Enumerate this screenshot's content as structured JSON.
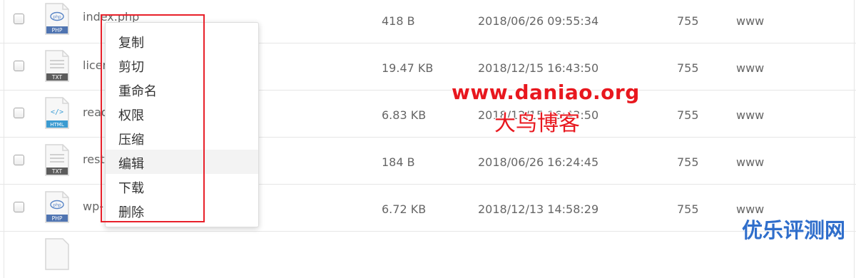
{
  "files": [
    {
      "name": "index.php",
      "type": "PHP",
      "size": "418 B",
      "modified": "2018/06/26 09:55:34",
      "permission": "755",
      "owner": "www"
    },
    {
      "name": "licer",
      "type": "TXT",
      "size": "19.47 KB",
      "modified": "2018/12/15 16:43:50",
      "permission": "755",
      "owner": "www"
    },
    {
      "name": "read",
      "type": "HTML",
      "size": "6.83 KB",
      "modified": "2018/12/15 16:43:50",
      "permission": "755",
      "owner": "www"
    },
    {
      "name": "resto",
      "type": "TXT",
      "size": "184 B",
      "modified": "2018/06/26 16:24:45",
      "permission": "755",
      "owner": "www"
    },
    {
      "name": "wp-",
      "type": "PHP",
      "size": "6.72 KB",
      "modified": "2018/12/13 14:58:29",
      "permission": "755",
      "owner": "www"
    }
  ],
  "context_menu": {
    "items": [
      "复制",
      "剪切",
      "重命名",
      "权限",
      "压缩",
      "编辑",
      "下载",
      "删除"
    ],
    "hovered": "编辑"
  },
  "watermark": {
    "url": "www.daniao.org",
    "name": "大鸟博客",
    "corner": "优乐评测网"
  },
  "colors": {
    "highlight_box": "#e8202a",
    "watermark_red": "#e8171e",
    "watermark_blue": "#2f6ecb"
  }
}
